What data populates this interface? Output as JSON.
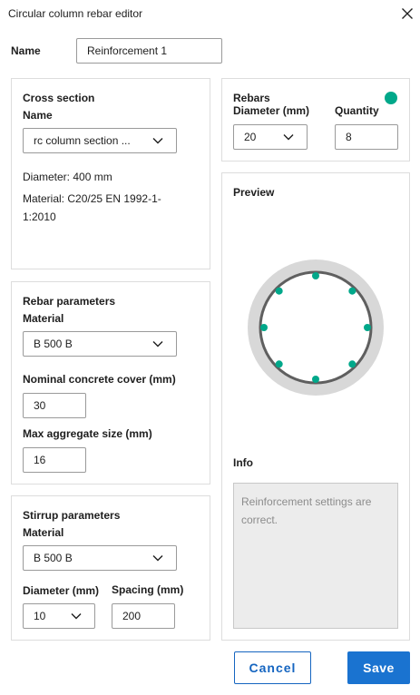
{
  "window": {
    "title": "Circular column rebar editor",
    "close_icon": "close-icon"
  },
  "name_field": {
    "label": "Name",
    "value": "Reinforcement 1"
  },
  "cross_section": {
    "heading": "Cross section",
    "name_label": "Name",
    "name_value": "rc column section ...",
    "diameter_text": "Diameter: 400 mm",
    "material_line1": "Material: C20/25 EN 1992-1-",
    "material_line2": "1:2010"
  },
  "rebar_parameters": {
    "heading": "Rebar parameters",
    "material_label": "Material",
    "material_value": "B 500 B",
    "cover_label": "Nominal concrete cover (mm)",
    "cover_value": "30",
    "aggregate_label": "Max aggregate size (mm)",
    "aggregate_value": "16"
  },
  "stirrup_parameters": {
    "heading": "Stirrup parameters",
    "material_label": "Material",
    "material_value": "B 500 B",
    "diameter_label": "Diameter (mm)",
    "diameter_value": "10",
    "spacing_label": "Spacing (mm)",
    "spacing_value": "200"
  },
  "rebars": {
    "heading": "Rebars",
    "diameter_label": "Diameter (mm)",
    "diameter_value": "20",
    "quantity_label": "Quantity",
    "quantity_value": "8",
    "status_color": "#00a88a"
  },
  "preview": {
    "heading": "Preview",
    "concrete_color": "#d8d8d8",
    "stirrup_color": "#5f5f5f",
    "rebar_color": "#00a88a",
    "rebar_count": 8
  },
  "info": {
    "heading": "Info",
    "message": "Reinforcement settings are correct."
  },
  "actions": {
    "cancel_label": "Cancel",
    "save_label": "Save"
  },
  "colors": {
    "accent": "#1a73d0",
    "border": "#dddddd"
  }
}
